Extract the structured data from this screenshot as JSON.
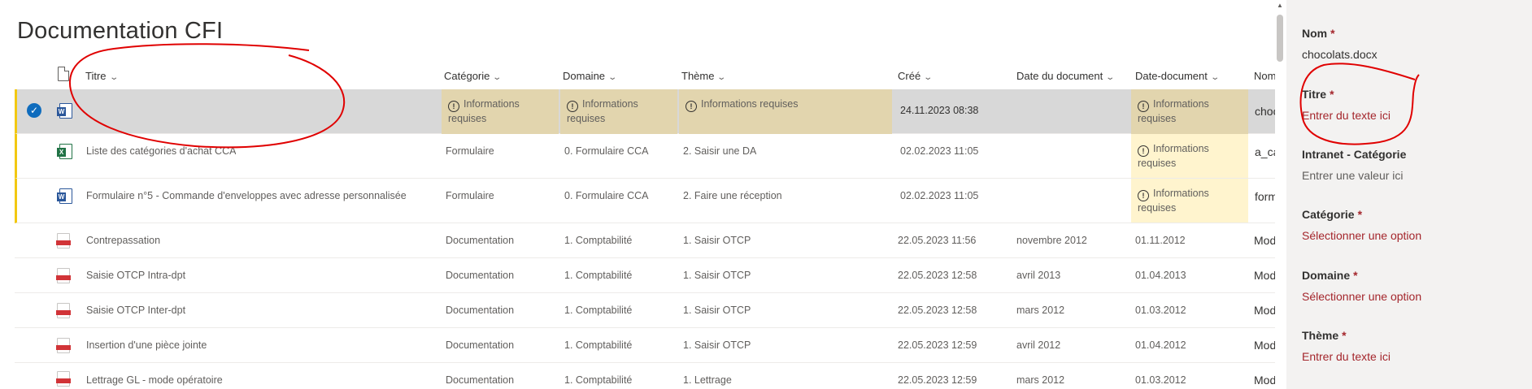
{
  "page_title": "Documentation CFI",
  "columns": {
    "titre": "Titre",
    "categorie": "Catégorie",
    "domaine": "Domaine",
    "theme": "Thème",
    "cree": "Créé",
    "date_du_document": "Date du document",
    "date_document": "Date-document",
    "nom": "Nom"
  },
  "rows": [
    {
      "type": "word",
      "selected": true,
      "titre": "",
      "categorie": "Informations requises",
      "domaine": "Informations requises",
      "theme": "Informations requises",
      "cree": "24.11.2023 08:38",
      "date_du_document": "",
      "date_document": "Informations requises",
      "nom": "choc"
    },
    {
      "type": "excel",
      "titre": "Liste des catégories d'achat CCA",
      "categorie": "Formulaire",
      "domaine": "0. Formulaire CCA",
      "theme": "2. Saisir une DA",
      "cree": "02.02.2023 11:05",
      "date_du_document": "",
      "date_document": "Informations requises",
      "nom": "a_ca"
    },
    {
      "type": "word",
      "titre": "Formulaire n°5 - Commande d'enveloppes avec adresse personnalisée",
      "categorie": "Formulaire",
      "domaine": "0. Formulaire CCA",
      "theme": "2. Faire une réception",
      "cree": "02.02.2023 11:05",
      "date_du_document": "",
      "date_document": "Informations requises",
      "nom": "form"
    },
    {
      "type": "pdf",
      "titre": "Contrepassation",
      "categorie": "Documentation",
      "domaine": "1. Comptabilité",
      "theme": "1. Saisir OTCP",
      "cree": "22.05.2023 11:56",
      "date_du_document": "novembre 2012",
      "date_document": "01.11.2012",
      "nom": "Mod"
    },
    {
      "type": "pdf",
      "titre": "Saisie OTCP Intra-dpt",
      "categorie": "Documentation",
      "domaine": "1. Comptabilité",
      "theme": "1. Saisir OTCP",
      "cree": "22.05.2023 12:58",
      "date_du_document": "avril 2013",
      "date_document": "01.04.2013",
      "nom": "Mod"
    },
    {
      "type": "pdf",
      "titre": "Saisie OTCP Inter-dpt",
      "categorie": "Documentation",
      "domaine": "1. Comptabilité",
      "theme": "1. Saisir OTCP",
      "cree": "22.05.2023 12:58",
      "date_du_document": "mars 2012",
      "date_document": "01.03.2012",
      "nom": "Mod"
    },
    {
      "type": "pdf",
      "titre": "Insertion d'une pièce jointe",
      "categorie": "Documentation",
      "domaine": "1. Comptabilité",
      "theme": "1. Saisir OTCP",
      "cree": "22.05.2023 12:59",
      "date_du_document": "avril 2012",
      "date_document": "01.04.2012",
      "nom": "Mod"
    },
    {
      "type": "pdf",
      "titre": "Lettrage GL - mode opératoire",
      "categorie": "Documentation",
      "domaine": "1. Comptabilité",
      "theme": "1. Lettrage",
      "cree": "22.05.2023 12:59",
      "date_du_document": "mars 2012",
      "date_document": "01.03.2012",
      "nom": "Mod"
    }
  ],
  "panel": {
    "nom": {
      "label": "Nom",
      "value": "chocolats.docx"
    },
    "titre": {
      "label": "Titre",
      "value": "Entrer du texte ici"
    },
    "intranet_categorie": {
      "label": "Intranet - Catégorie",
      "value": "Entrer une valeur ici"
    },
    "categorie": {
      "label": "Catégorie",
      "value": "Sélectionner une option"
    },
    "domaine": {
      "label": "Domaine",
      "value": "Sélectionner une option"
    },
    "theme": {
      "label": "Thème",
      "value": "Entrer du texte ici"
    },
    "required_mark": "*"
  },
  "icons": {
    "word": "word-file-icon",
    "excel": "excel-file-icon",
    "pdf": "pdf-file-icon",
    "warning": "warning-circle-icon",
    "check": "checkmark-icon"
  },
  "colors": {
    "selected_row": "#d8d8d8",
    "required_cell_selected": "#e2d5ae",
    "required_cell": "#fff4ce",
    "accent_bar": "#f2c811",
    "error_text": "#a4262c",
    "annotation": "#e00000"
  }
}
